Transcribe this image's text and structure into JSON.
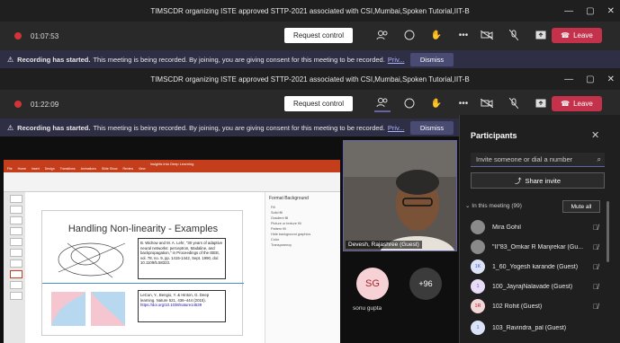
{
  "window_title": "TIMSCDR organizing ISTE approved STTP-2021 associated with CSI,Mumbai,Spoken Tutorial,IIT-B",
  "top_window": {
    "timer": "01:07:53"
  },
  "main_window": {
    "timer": "01:22:09"
  },
  "toolbar": {
    "request_control": "Request control",
    "leave": "Leave",
    "more": "•••"
  },
  "banner": {
    "bold": "Recording has started.",
    "text": "This meeting is being recorded. By joining, you are giving consent for this meeting to be recorded.",
    "link": "Priv...",
    "dismiss": "Dismiss"
  },
  "ppt": {
    "title_bar": "Insights into Deep Learning",
    "tabs": [
      "File",
      "Home",
      "Insert",
      "Design",
      "Transitions",
      "Animations",
      "Slide Show",
      "Review",
      "View"
    ],
    "slide_title": "Handling Non-linearity - Examples",
    "ref1": "B. Widrow and M. A. Lehr, \"30 years of adaptive neural networks: perceptron, Madaline, and backpropagation,\" in Proceedings of the IEEE, vol. 78, no. 9, pp. 1415-1442, Sept. 1990, doi: 10.1109/5.58323.",
    "ref2_a": "LeCun, Y., Bengio, Y. & Hinton, G. Deep learning. Nature 521, 436–444 (2015).",
    "ref2_link": "https://doi.org/10.1038/nature14539",
    "side_title": "Format Background",
    "side_lines": [
      "Fill",
      "Solid fill",
      "Gradient fill",
      "Picture or texture fill",
      "Pattern fill",
      "Hide background graphics",
      "Color",
      "Transparency"
    ]
  },
  "video": {
    "name": "Devesh, Rajashree (Guest)"
  },
  "tiles": [
    {
      "initials": "SG",
      "label": "sonu gupta"
    },
    {
      "initials": "+96",
      "label": ""
    }
  ],
  "participants": {
    "title": "Participants",
    "input_placeholder": "Invite someone or dial a number",
    "share_invite": "Share invite",
    "section": "In this meeting (99)",
    "mute_all": "Mute all",
    "people": [
      {
        "initials": "",
        "name": "Mira Gohil"
      },
      {
        "initials": "",
        "name": "\"II\"83_Omkar R Manjrekar (Gu..."
      },
      {
        "initials": "1K",
        "name": "1_60_Yogesh karande (Guest)"
      },
      {
        "initials": "1",
        "name": "100_JayrajNalavade (Guest)"
      },
      {
        "initials": "1R",
        "name": "102 Rohit (Guest)"
      },
      {
        "initials": "1",
        "name": "103_Ravindra_pal (Guest)"
      }
    ]
  }
}
